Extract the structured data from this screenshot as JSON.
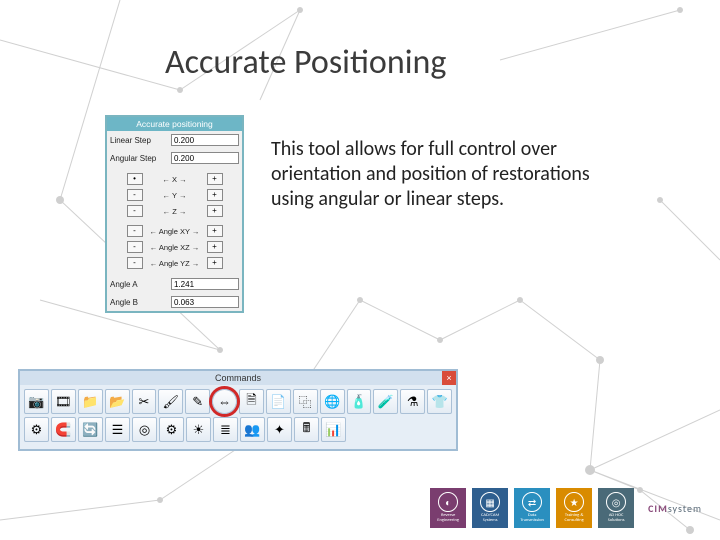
{
  "title": "Accurate Positioning",
  "body": "This tool allows for full control over orientation and position of restorations using angular or linear steps.",
  "panel": {
    "header": "Accurate positioning",
    "linear_step_label": "Linear Step",
    "linear_step_value": "0.200",
    "angular_step_label": "Angular Step",
    "angular_step_value": "0.200",
    "axis_x": "←   X   →",
    "axis_y": "←   Y   →",
    "axis_z": "←   Z   →",
    "axis_xy": "←  Angle XY  →",
    "axis_xz": "←  Angle XZ  →",
    "axis_yz": "←  Angle YZ  →",
    "angle_a_label": "Angle A",
    "angle_a_value": "1.241",
    "angle_b_label": "Angle B",
    "angle_b_value": "0.063",
    "minus": "-",
    "plus": "+",
    "dot": "•"
  },
  "toolbar": {
    "header": "Commands",
    "close": "×"
  },
  "brands": {
    "b1": "Reverse Engineering",
    "b2": "CAD/CAM Systems",
    "b3": "Data Transmission",
    "b4": "Training & Consulting",
    "b5": "AD HOC Solutions",
    "cim_prefix": "CIM",
    "cim_suffix": "system"
  }
}
